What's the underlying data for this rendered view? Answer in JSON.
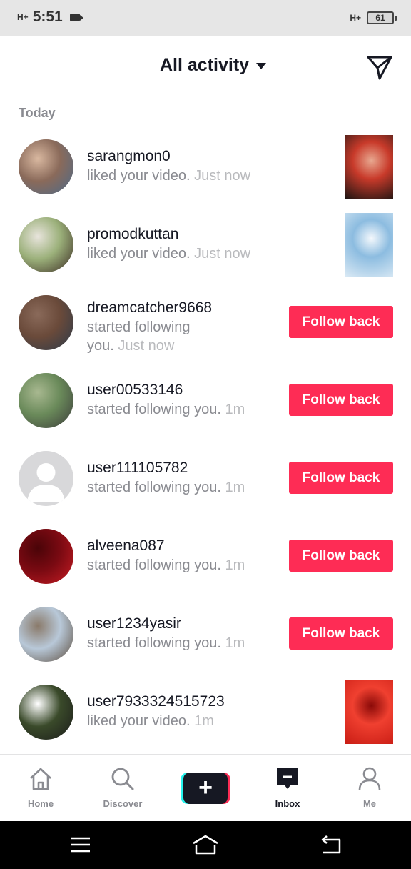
{
  "status_bar": {
    "network_left": "H+",
    "time": "5:51",
    "network_right": "H+",
    "battery": "61"
  },
  "header": {
    "title": "All activity",
    "dropdown_icon": "caret-down-icon",
    "send_icon": "paper-plane-icon"
  },
  "section": {
    "label": "Today"
  },
  "activities": [
    {
      "username": "sarangmon0",
      "action": "liked your video.",
      "time": "Just now",
      "right": "thumbnail",
      "avatar_colors": [
        "#8a6a5a",
        "#4a6a8a",
        "#d9b8a0"
      ],
      "thumb_colors": [
        "#1a1412",
        "#c83a2a",
        "#e8a890"
      ]
    },
    {
      "username": "promodkuttan",
      "action": "liked your video.",
      "time": "Just now",
      "right": "thumbnail",
      "avatar_colors": [
        "#9bb07a",
        "#3a2a22",
        "#e8e4dc"
      ],
      "thumb_colors": [
        "#dbeaf5",
        "#8cbce0",
        "#f4f8fc"
      ]
    },
    {
      "username": "dreamcatcher9668",
      "action": "started following",
      "action_line2": "you.",
      "time": "Just now",
      "right": "follow",
      "avatar_colors": [
        "#6a4a3a",
        "#2a3a4a",
        "#8a6a5a"
      ]
    },
    {
      "username": "user00533146",
      "action": "started following you.",
      "time": "1m",
      "right": "follow",
      "avatar_colors": [
        "#6a8a5a",
        "#3a3a3a",
        "#a8b890"
      ]
    },
    {
      "username": "user111105782",
      "action": "started following you.",
      "time": "1m",
      "right": "follow",
      "avatar_colors": [
        "#d8d8da",
        "#ffffff",
        "#d8d8da"
      ]
    },
    {
      "username": "alveena087",
      "action": "started following you.",
      "time": "1m",
      "right": "follow",
      "avatar_colors": [
        "#7a0a12",
        "#c81c24",
        "#4a0408"
      ]
    },
    {
      "username": "user1234yasir",
      "action": "started following you.",
      "time": "1m",
      "right": "follow",
      "avatar_colors": [
        "#b8c8d8",
        "#5a4a3a",
        "#8a7a6a"
      ]
    },
    {
      "username": "user7933324515723",
      "action": "liked your video.",
      "time": "1m",
      "right": "thumbnail",
      "avatar_colors": [
        "#3a4a2a",
        "#1a1a1a",
        "#ffffff"
      ],
      "thumb_colors": [
        "#c81c14",
        "#f04030",
        "#8a0a08"
      ]
    }
  ],
  "follow_back_label": "Follow back",
  "bottom_nav": {
    "items": [
      {
        "label": "Home",
        "icon": "home-icon"
      },
      {
        "label": "Discover",
        "icon": "search-icon"
      },
      {
        "label": "",
        "icon": "plus-icon"
      },
      {
        "label": "Inbox",
        "icon": "inbox-icon"
      },
      {
        "label": "Me",
        "icon": "person-icon"
      }
    ],
    "active": "Inbox"
  },
  "system_nav": {
    "icons": [
      "menu-icon",
      "home-outline-icon",
      "back-icon"
    ]
  },
  "colors": {
    "accent": "#fe2c55",
    "text_primary": "#161823",
    "text_secondary": "#8a8b91",
    "text_tertiary": "#b9babd"
  }
}
